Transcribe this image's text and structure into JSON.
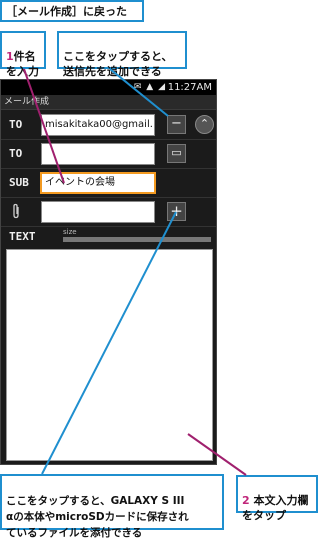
{
  "header_label": "［メール作成］に戻った",
  "callouts": {
    "step1_num": "1",
    "step1_text": "件名\nを入力",
    "tap_add_recipient": "ここをタップすると、\n送信先を追加できる",
    "step2_num": "2",
    "step2_text": "本文入力欄\nをタップ",
    "tap_attach": "ここをタップすると、GALAXY S III\nαの本体やmicroSDカードに保存され\nているファイルを添付できる"
  },
  "phone": {
    "status": {
      "icons": "✉ ▲ ◢",
      "time": "11:27AM"
    },
    "title": "メール作成",
    "rows": [
      {
        "label": "TO",
        "value": "misakitaka00@gmail.",
        "button": "−",
        "extra": "⌃"
      },
      {
        "label": "TO",
        "value": "",
        "button": "▭"
      },
      {
        "label": "SUB",
        "value": "イベントの会場"
      },
      {
        "label": "📎",
        "value": "",
        "button": "+"
      }
    ],
    "text_label": "TEXT",
    "size_label": "size"
  },
  "colors": {
    "callout_border": "#1f8fcf",
    "step_number": "#c0267a",
    "leader_line": "#a0206e",
    "active_field": "#f39a21"
  }
}
